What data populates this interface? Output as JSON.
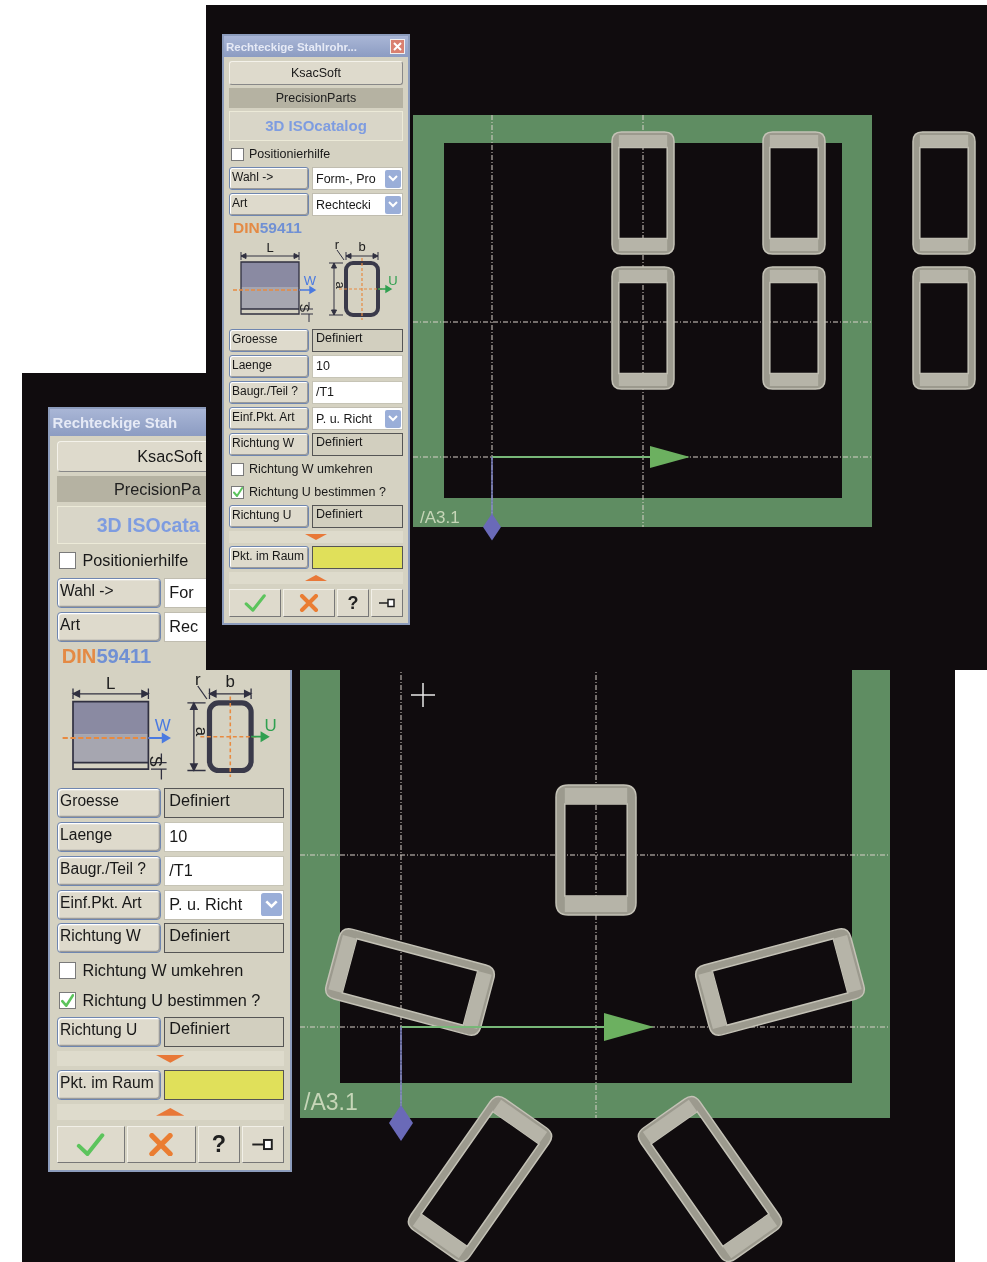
{
  "screens": [
    {
      "panel": {
        "title": "Rechteckige Stah",
        "items": [
          {
            "kind": "button",
            "label": "KsacSoft"
          },
          {
            "kind": "banner",
            "label": "PrecisionPa"
          },
          {
            "kind": "logo",
            "label": "3D ISOcata"
          },
          {
            "kind": "checkbox",
            "label": "Positionierhilfe",
            "checked": false
          },
          {
            "kind": "covered",
            "label": "Wahl ->",
            "value": "For"
          },
          {
            "kind": "covered",
            "label": "Art",
            "value": "Rec"
          },
          {
            "kind": "standard",
            "prefix": "DIN",
            "number": "59411"
          },
          {
            "kind": "diagram",
            "labels": [
              "L",
              "W",
              "S",
              "r",
              "b",
              "a",
              "U"
            ]
          },
          {
            "kind": "readonly",
            "label": "Groesse",
            "value": "Definiert"
          },
          {
            "kind": "input",
            "label": "Laenge",
            "value": "10"
          },
          {
            "kind": "input",
            "label": "Baugr./Teil ?",
            "value": "/T1"
          },
          {
            "kind": "select",
            "label": "Einf.Pkt. Art",
            "value": "P. u. Richt"
          },
          {
            "kind": "readonly",
            "label": "Richtung W",
            "value": "Definiert"
          },
          {
            "kind": "checkbox",
            "label": "Richtung W umkehren",
            "checked": false
          },
          {
            "kind": "checkbox",
            "label": "Richtung U bestimmen ?",
            "checked": true
          },
          {
            "kind": "readonly",
            "label": "Richtung U",
            "value": "Definiert"
          },
          {
            "kind": "expand"
          },
          {
            "kind": "swatch",
            "label": "Pkt. im Raum",
            "color": "#e0e05a"
          },
          {
            "kind": "collapse"
          },
          {
            "kind": "toolbar",
            "buttons": [
              {
                "kind": "ok"
              },
              {
                "kind": "cancel"
              },
              {
                "kind": "help",
                "label": "?"
              },
              {
                "kind": "pin"
              }
            ]
          }
        ]
      },
      "viewport": {
        "label": "/A3.1"
      }
    },
    {
      "panel": {
        "title": "Rechteckige Stahlrohr...",
        "controls": [
          {
            "kind": "close"
          }
        ],
        "items": [
          {
            "kind": "button",
            "label": "KsacSoft"
          },
          {
            "kind": "banner",
            "label": "PrecisionParts"
          },
          {
            "kind": "logo",
            "label": "3D ISOcatalog"
          },
          {
            "kind": "checkbox",
            "label": "Positionierhilfe",
            "checked": false
          },
          {
            "kind": "select",
            "label": "Wahl ->",
            "value": "Form-, Pro"
          },
          {
            "kind": "select",
            "label": "Art",
            "value": "Rechtecki"
          },
          {
            "kind": "standard",
            "prefix": "DIN",
            "number": "59411"
          },
          {
            "kind": "diagram",
            "labels": [
              "L",
              "W",
              "S",
              "r",
              "b",
              "a",
              "U"
            ]
          },
          {
            "kind": "readonly",
            "label": "Groesse",
            "value": "Definiert"
          },
          {
            "kind": "input",
            "label": "Laenge",
            "value": "10"
          },
          {
            "kind": "input",
            "label": "Baugr./Teil ?",
            "value": "/T1"
          },
          {
            "kind": "select",
            "label": "Einf.Pkt. Art",
            "value": "P. u. Richt"
          },
          {
            "kind": "readonly",
            "label": "Richtung W",
            "value": "Definiert"
          },
          {
            "kind": "checkbox",
            "label": "Richtung W umkehren",
            "checked": false
          },
          {
            "kind": "checkbox",
            "label": "Richtung U bestimmen ?",
            "checked": true
          },
          {
            "kind": "readonly",
            "label": "Richtung U",
            "value": "Definiert"
          },
          {
            "kind": "expand"
          },
          {
            "kind": "swatch",
            "label": "Pkt. im Raum",
            "color": "#e0e05a"
          },
          {
            "kind": "collapse"
          },
          {
            "kind": "toolbar",
            "buttons": [
              {
                "kind": "ok"
              },
              {
                "kind": "cancel"
              },
              {
                "kind": "help",
                "label": "?"
              },
              {
                "kind": "pin"
              }
            ]
          }
        ]
      },
      "viewport": {
        "label": "/A3.1"
      }
    }
  ]
}
